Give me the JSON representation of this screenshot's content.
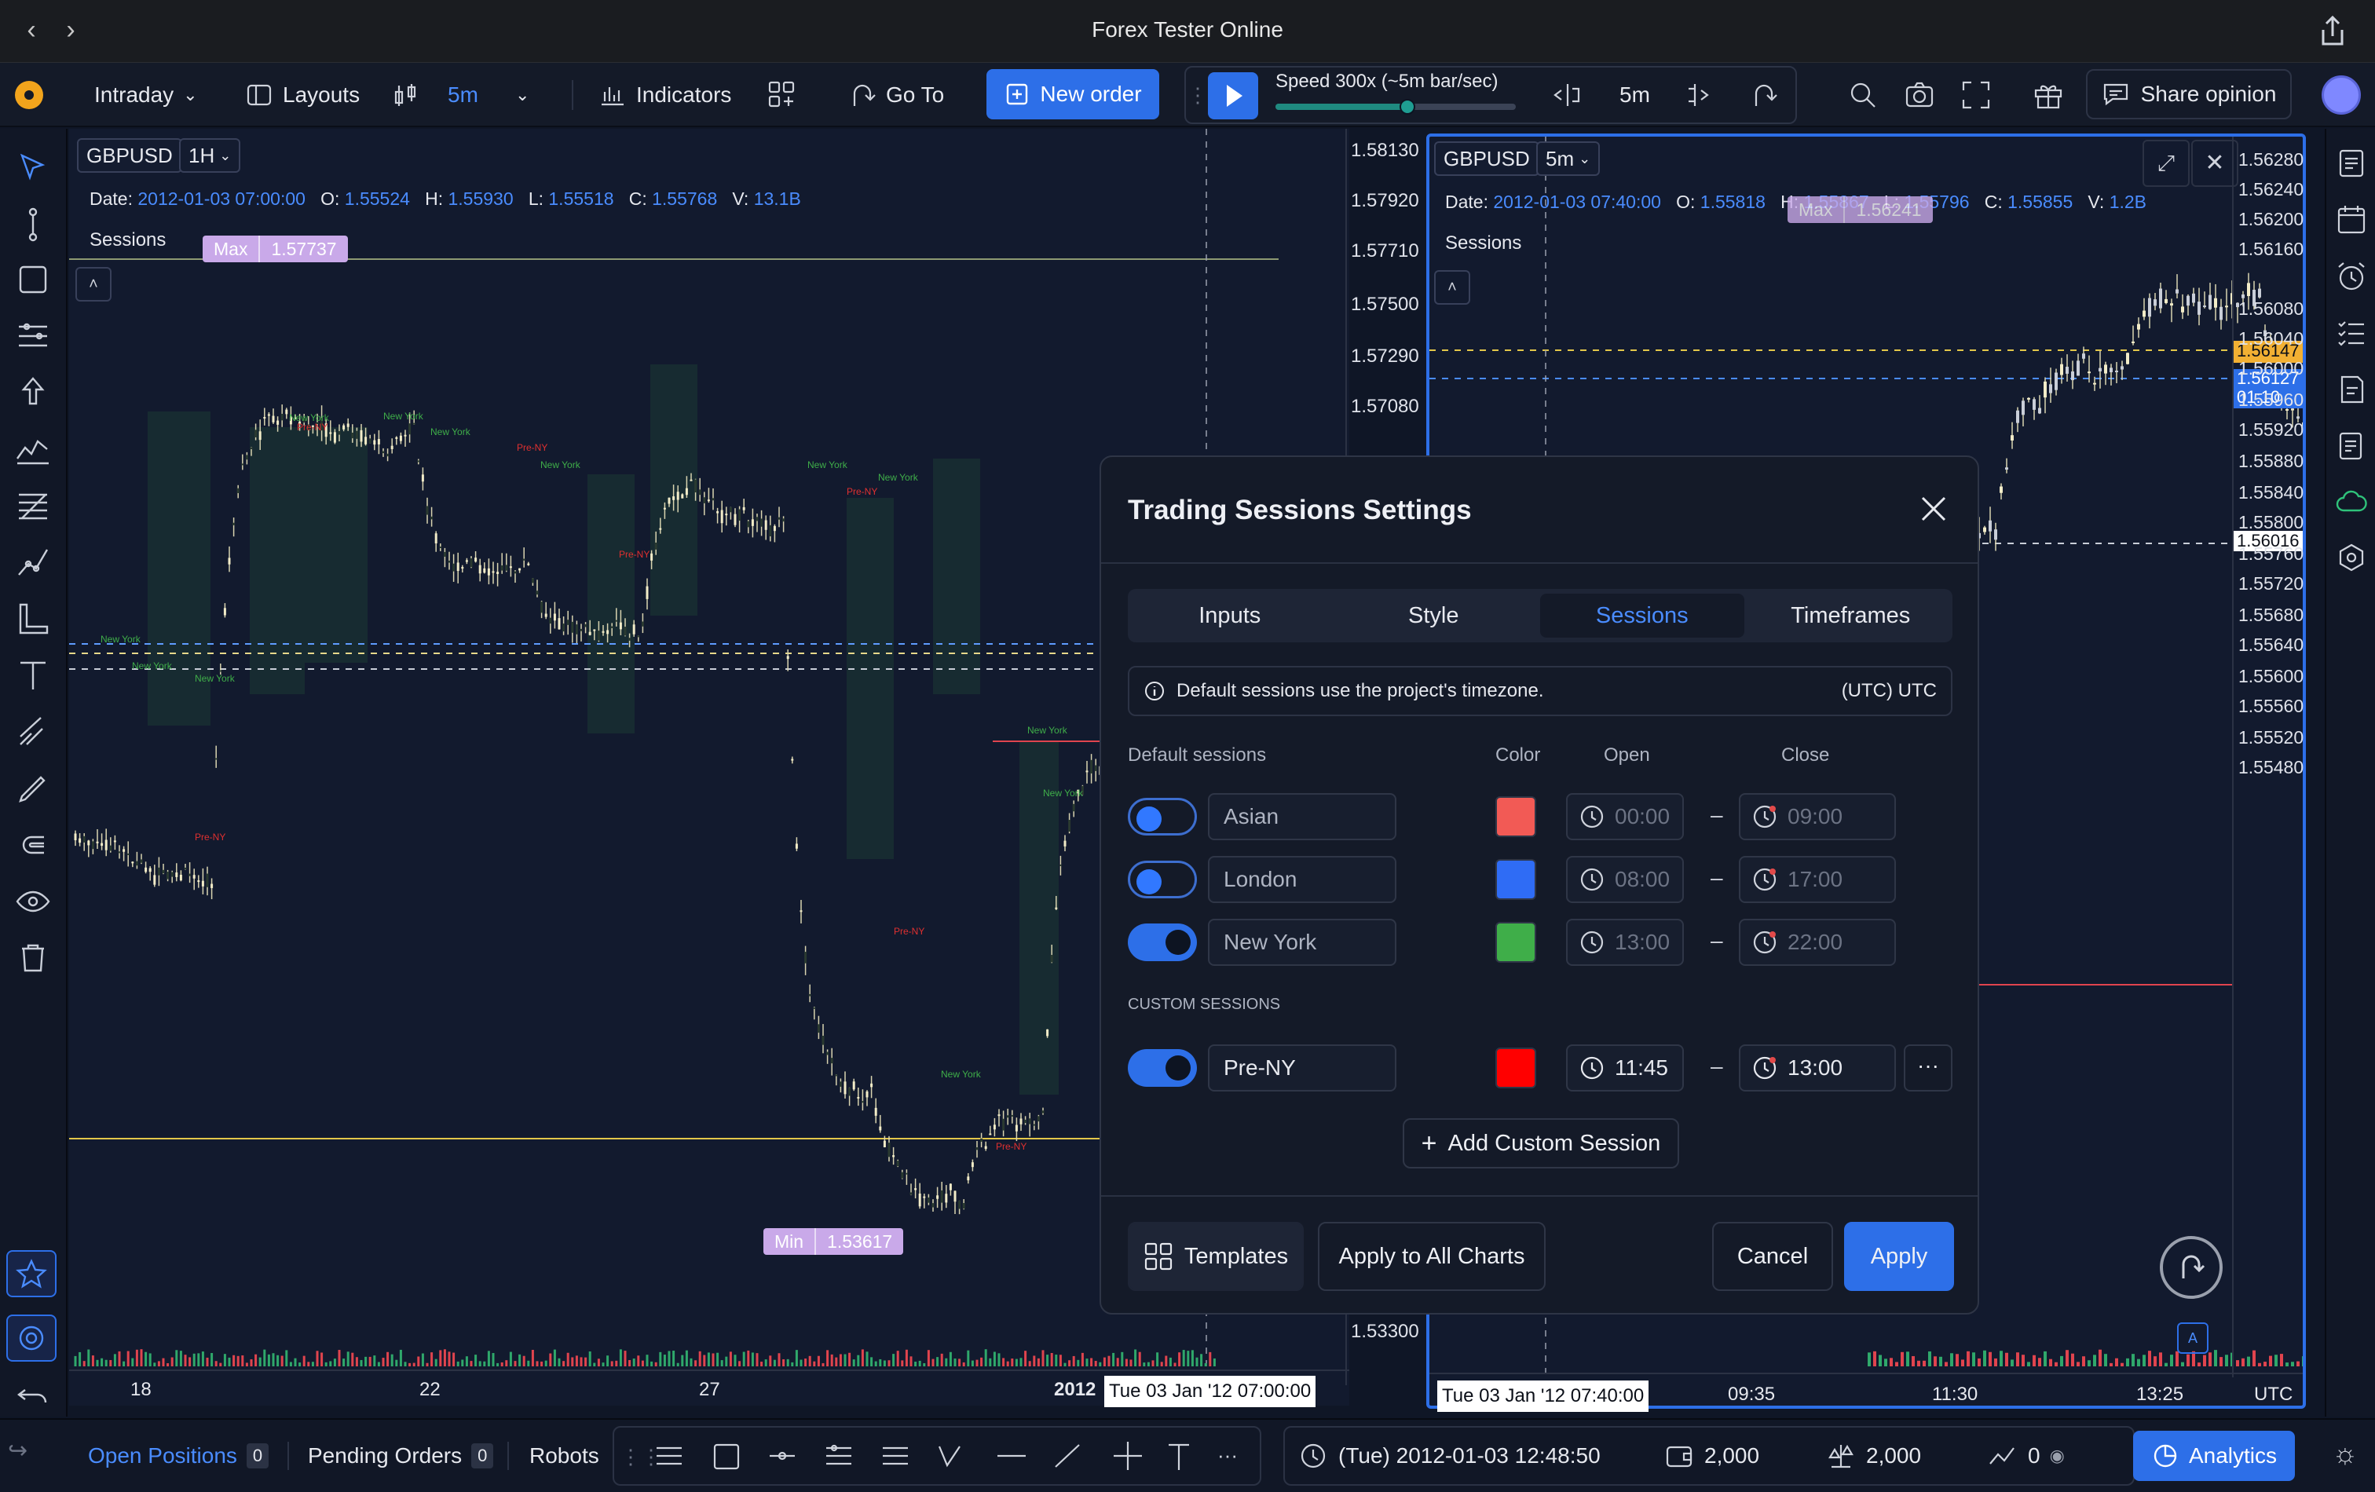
{
  "window": {
    "title": "Forex Tester Online"
  },
  "toolbar": {
    "mode": "Intraday",
    "layouts": "Layouts",
    "timeframe": "5m",
    "indicators": "Indicators",
    "goto": "Go To",
    "new_order": "New order",
    "speed": "Speed 300x (~5m bar/sec)",
    "speed_level": 0.55,
    "step_tf": "5m",
    "share": "Share opinion"
  },
  "chart_left": {
    "symbol": "GBPUSD",
    "timeframe": "1H",
    "ohlc": {
      "date_label": "Date:",
      "date": "2012-01-03 07:00:00",
      "o_label": "O:",
      "o": "1.55524",
      "h_label": "H:",
      "h": "1.55930",
      "l_label": "L:",
      "l": "1.55518",
      "c_label": "C:",
      "c": "1.55768",
      "v_label": "V:",
      "v": "13.1B"
    },
    "indicator": "Sessions",
    "max_label": "Max",
    "max_value": "1.57737",
    "min_label": "Min",
    "min_value": "1.53617",
    "price_scale": [
      "1.58130",
      "1.57920",
      "1.57710",
      "1.57500",
      "1.57290",
      "1.57080",
      "1.53300"
    ],
    "time_axis": [
      "18",
      "22",
      "27",
      "2012"
    ],
    "crosshair_time": "Tue 03 Jan '12 07:00:00"
  },
  "chart_right": {
    "symbol": "GBPUSD",
    "timeframe": "5m",
    "ohlc": {
      "date_label": "Date:",
      "date": "2012-01-03 07:40:00",
      "o_label": "O:",
      "o": "1.55818",
      "h_label": "H:",
      "h": "1.55867",
      "l_label": "L:",
      "l": "1.55796",
      "c_label": "C:",
      "c": "1.55855",
      "v_label": "V:",
      "v": "1.2B"
    },
    "indicator": "Sessions",
    "max_label": "Max",
    "max_value": "1.56241",
    "price_scale": [
      "1.56280",
      "1.56240",
      "1.56200",
      "1.56160",
      "1.56080",
      "1.56040",
      "1.56000",
      "1.55960",
      "1.55920",
      "1.55880",
      "1.55840",
      "1.55800",
      "1.55760",
      "1.55720",
      "1.55680",
      "1.55640",
      "1.55600",
      "1.55560",
      "1.55520",
      "1.55480"
    ],
    "price_tag_1": "1.56147",
    "price_tag_2": "1.56127",
    "countdown": "01:10",
    "price_tag_3": "1.56016",
    "time_axis": [
      "09:35",
      "11:30",
      "13:25"
    ],
    "timezone": "UTC",
    "crosshair_time": "Tue 03 Jan '12 07:40:00"
  },
  "dialog": {
    "title": "Trading Sessions Settings",
    "tabs": [
      "Inputs",
      "Style",
      "Sessions",
      "Timeframes"
    ],
    "active_tab": "Sessions",
    "notice": "Default sessions use the project's timezone.",
    "timezone": "(UTC) UTC",
    "default_header": "Default sessions",
    "color_header": "Color",
    "open_header": "Open",
    "close_header": "Close",
    "sessions": [
      {
        "name": "Asian",
        "enabled": false,
        "color": "#f25a55",
        "open": "00:00",
        "close": "09:00"
      },
      {
        "name": "London",
        "enabled": false,
        "color": "#2f6cf5",
        "open": "08:00",
        "close": "17:00"
      },
      {
        "name": "New York",
        "enabled": true,
        "color": "#3fae49",
        "open": "13:00",
        "close": "22:00"
      }
    ],
    "custom_header": "CUSTOM SESSIONS",
    "custom": [
      {
        "name": "Pre-NY",
        "enabled": true,
        "color": "#ff0000",
        "open": "11:45",
        "close": "13:00"
      }
    ],
    "add_custom": "Add Custom Session",
    "templates": "Templates",
    "apply_all": "Apply to All Charts",
    "cancel": "Cancel",
    "apply": "Apply"
  },
  "bottombar": {
    "open_positions": "Open Positions",
    "open_count": "0",
    "pending_orders": "Pending Orders",
    "pending_count": "0",
    "robots": "Robots",
    "datetime": "(Tue) 2012-01-03 12:48:50",
    "balance": "2,000",
    "equity": "2,000",
    "pl": "0",
    "analytics": "Analytics"
  },
  "colors": {
    "accent": "#2d6fe8",
    "session_label": "#3fae49",
    "pre_ny_label": "#e03030"
  }
}
